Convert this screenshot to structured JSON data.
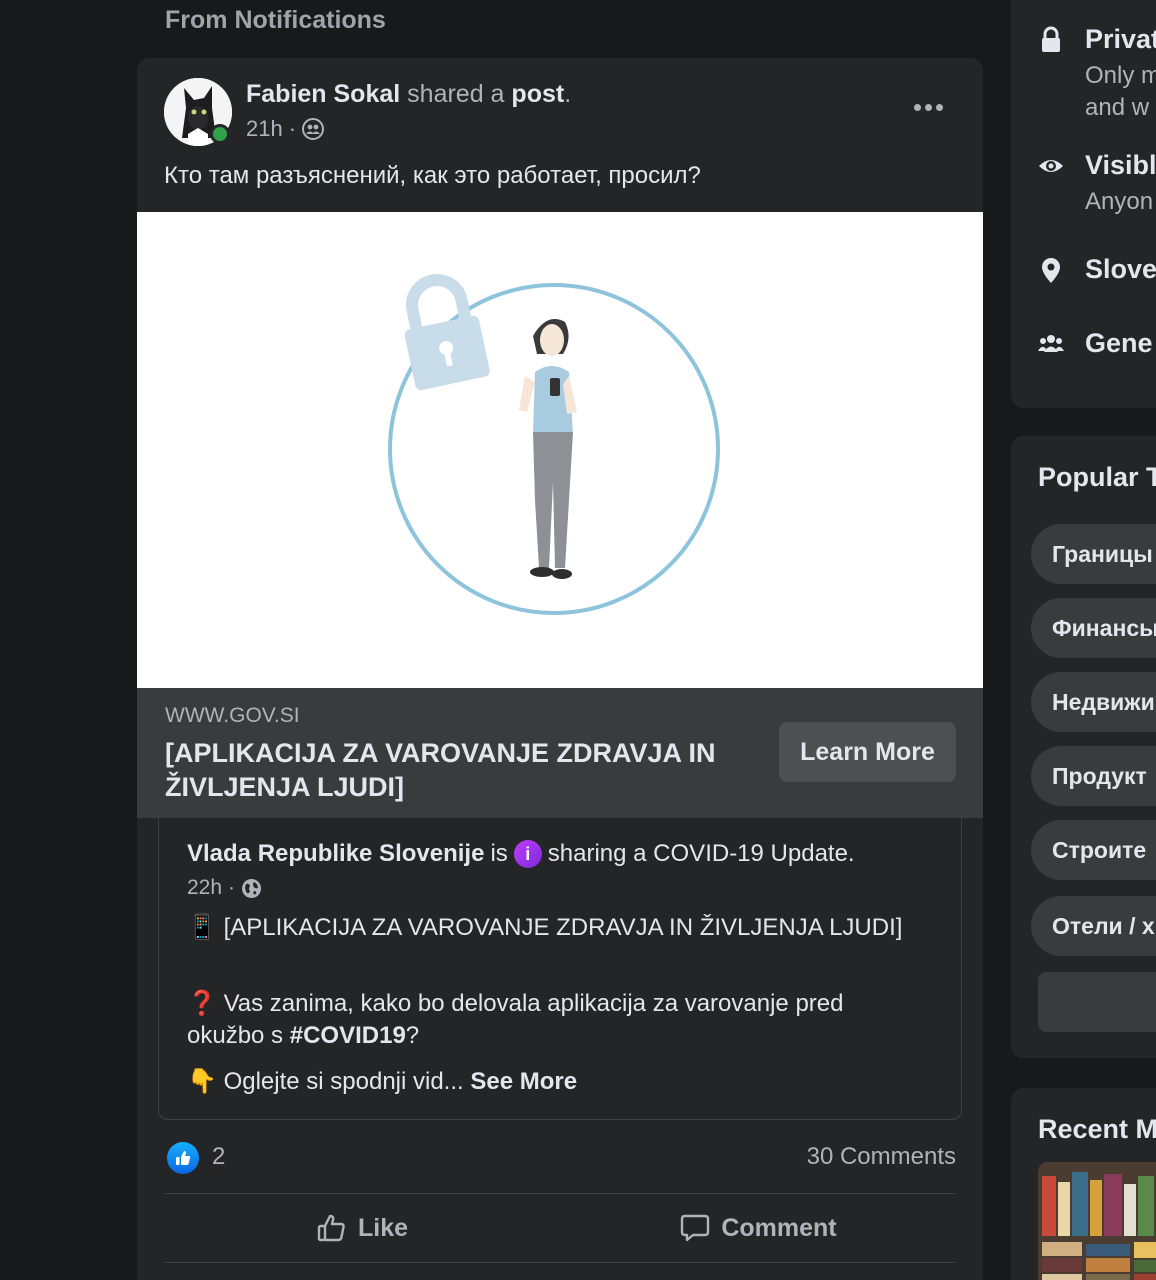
{
  "feed": {
    "section_heading": "From Notifications"
  },
  "post": {
    "author": "Fabien Sokal",
    "shared_a": "shared a",
    "post_word": "post",
    "period": ".",
    "time": "21h",
    "separator": "·",
    "audience_icon": "friends-icon",
    "text": "Кто там разъяснений, как это работает, просил?",
    "link": {
      "domain": "WWW.GOV.SI",
      "title": "[APLIKACIJA ZA VAROVANJE ZDRAVJA IN ŽIVLJENJA LJUDI]",
      "button": "Learn More"
    },
    "shared": {
      "author": "Vlada Republike Slovenije",
      "is": "is",
      "info_symbol": "i",
      "activity": "sharing a COVID-19 Update.",
      "time": "22h",
      "separator": "·",
      "audience_icon": "globe-icon",
      "para1_emoji": "📱",
      "para1_text": "[APLIKACIJA ZA VAROVANJE ZDRAVJA IN ŽIVLJENJA LJUDI]",
      "para2_emoji": "❓",
      "para2_text": "Vas zanima, kako bo delovala aplikacija za varovanje pred okužbo s",
      "para2_hashtag": "#COVID19",
      "para2_end": "?",
      "para3_emoji": "👇",
      "para3_text": "Oglejte si spodnji vid...",
      "see_more": "See More"
    },
    "reactions": {
      "like_count": "2",
      "comments": "30 Comments"
    },
    "actions": {
      "like": "Like",
      "comment": "Comment"
    }
  },
  "about": {
    "privacy_title": "Privat",
    "privacy_sub1": "Only m",
    "privacy_sub2": "and w",
    "visible_title": "Visibl",
    "visible_sub": "Anyon",
    "location": "Slove",
    "group_type": "Gene"
  },
  "popular": {
    "heading": "Popular T",
    "topics": [
      "Границы",
      "Финансы",
      "Недвижи",
      "Продукт",
      "Строите",
      "Отели / х"
    ]
  },
  "recent": {
    "heading": "Recent M"
  },
  "colors": {
    "background": "#18191a",
    "card": "#242526",
    "accent_blue": "#0a66e4",
    "online_green": "#31a24c",
    "ring_blue": "#8ec3dc"
  }
}
